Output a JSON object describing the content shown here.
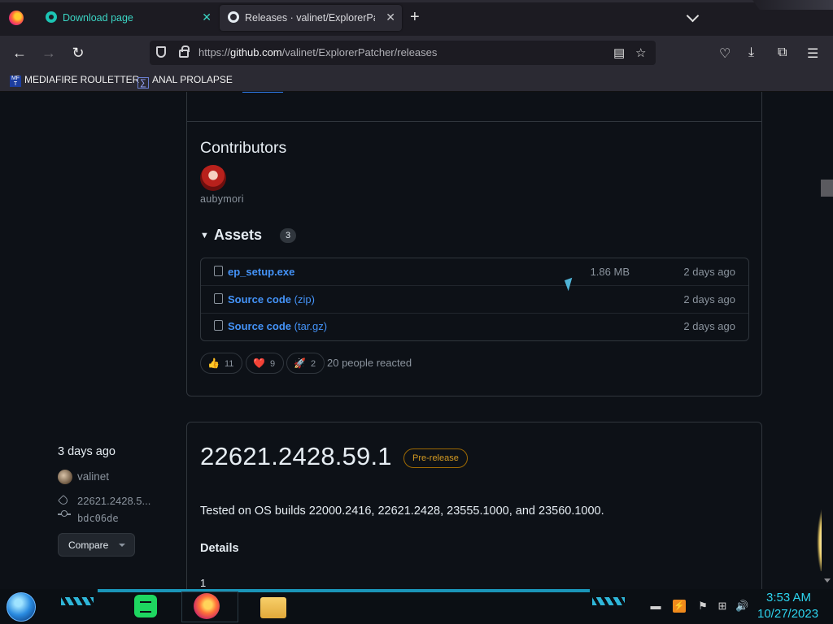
{
  "browser": {
    "tabs": [
      {
        "title": "Download page",
        "active": false
      },
      {
        "title": "Releases · valinet/ExplorerPatche",
        "active": true
      }
    ],
    "new_tab_label": "+",
    "url_prefix": "https://",
    "url_host": "github.com",
    "url_path": "/valinet/ExplorerPatcher/releases",
    "bookmarks": [
      {
        "label": "MEDIAFIRE ROULETTER",
        "icon": "mediafire-icon"
      },
      {
        "label": "ANAL PROLAPSE",
        "icon": "sigma-icon"
      }
    ]
  },
  "release1": {
    "contributors_heading": "Contributors",
    "contributor_name": "aubymori",
    "assets_heading": "Assets",
    "assets_count": "3",
    "assets": [
      {
        "name": "ep_setup.exe",
        "suffix": "",
        "size": "1.86 MB",
        "date": "2 days ago",
        "icon": "package-icon"
      },
      {
        "name": "Source code",
        "suffix": " (zip)",
        "size": "",
        "date": "2 days ago",
        "icon": "file-zip-icon"
      },
      {
        "name": "Source code",
        "suffix": " (tar.gz)",
        "size": "",
        "date": "2 days ago",
        "icon": "file-zip-icon"
      }
    ],
    "reactions": [
      {
        "emoji": "👍",
        "count": "11"
      },
      {
        "emoji": "❤️",
        "count": "9"
      },
      {
        "emoji": "🚀",
        "count": "2"
      }
    ],
    "reaction_summary": "20 people reacted"
  },
  "release2": {
    "date": "3 days ago",
    "author": "valinet",
    "tag": "22621.2428.5...",
    "commit": "bdc06de",
    "compare_label": "Compare",
    "title": "22621.2428.59.1",
    "badge": "Pre-release",
    "body": "Tested on OS builds 22000.2416, 22621.2428, 23555.1000, and 23560.1000.",
    "details_heading": "Details",
    "list_start": "1"
  },
  "taskbar": {
    "time": "3:53 AM",
    "date": "10/27/2023"
  },
  "colors": {
    "page_bg": "#0d1117",
    "link": "#4493f8",
    "prerelease": "#d29922",
    "clock": "#2dd4ee"
  }
}
